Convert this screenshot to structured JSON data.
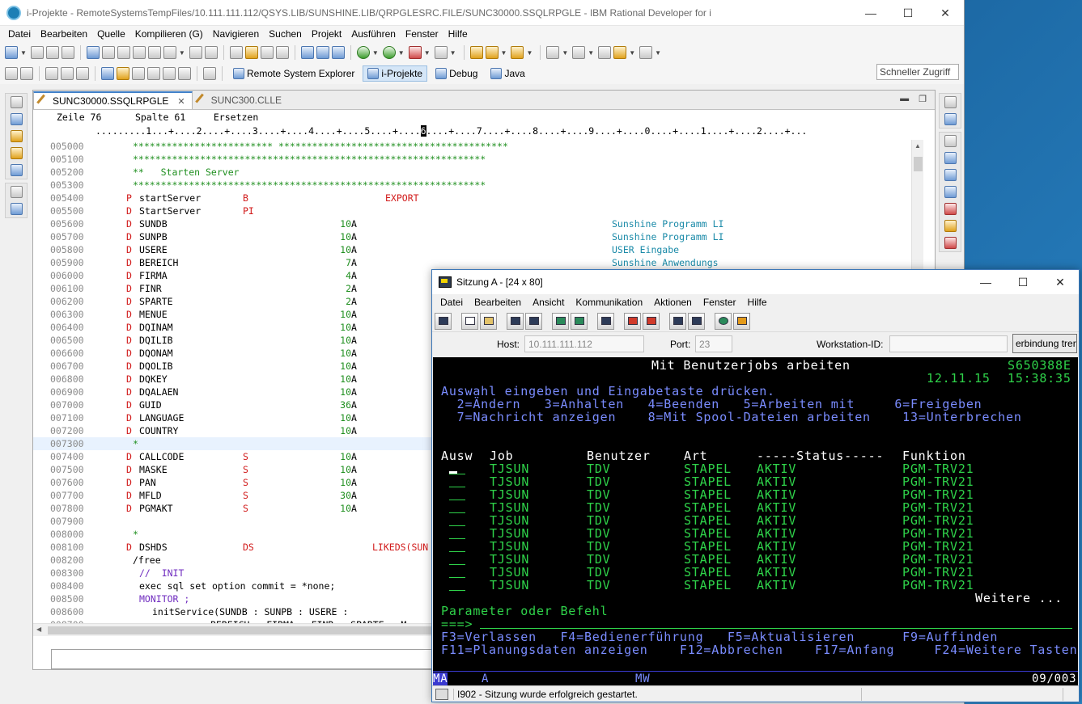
{
  "rdi": {
    "title": "i-Projekte - RemoteSystemsTempFiles/10.111.111.112/QSYS.LIB/SUNSHINE.LIB/QRPGLESRC.FILE/SUNC30000.SSQLRPGLE - IBM Rational Developer for i",
    "menu": [
      "Datei",
      "Bearbeiten",
      "Quelle",
      "Kompilieren (G)",
      "Navigieren",
      "Suchen",
      "Projekt",
      "Ausführen",
      "Fenster",
      "Hilfe"
    ],
    "perspectives": [
      {
        "label": "Remote System Explorer",
        "active": false
      },
      {
        "label": "i-Projekte",
        "active": true
      },
      {
        "label": "Debug",
        "active": false
      },
      {
        "label": "Java",
        "active": false
      }
    ],
    "quick_access": "Schneller Zugriff",
    "tabs": [
      {
        "label": "SUNC30000.SSQLRPGLE",
        "active": true
      },
      {
        "label": "SUNC300.CLLE",
        "active": false
      }
    ],
    "status": {
      "zeile": "Zeile 76",
      "spalte": "Spalte 61",
      "mode": "Ersetzen"
    },
    "ruler": ".........1...+....2....+....3....+....4....+....5....+....6....+....7....+....8....+....9....+....0....+....1....+....2....+...",
    "code": [
      {
        "seq": "005000",
        "star": "************************* *****************************************"
      },
      {
        "seq": "005100",
        "star": "***************************************************************"
      },
      {
        "seq": "005200",
        "star": "**   Starten Server"
      },
      {
        "seq": "005300",
        "star": "***************************************************************"
      },
      {
        "seq": "005400",
        "spec": "P",
        "name": "startServer",
        "kw": "B",
        "kwd": "EXPORT"
      },
      {
        "seq": "005500",
        "spec": "D",
        "name": "StartServer",
        "kw": "PI"
      },
      {
        "seq": "005600",
        "spec": "D",
        "name": "SUNDB",
        "len": "10",
        "typ": "A",
        "cmt": "Sunshine Programm LI"
      },
      {
        "seq": "005700",
        "spec": "D",
        "name": "SUNPB",
        "len": "10",
        "typ": "A",
        "cmt": "Sunshine Programm LI"
      },
      {
        "seq": "005800",
        "spec": "D",
        "name": "USERE",
        "len": "10",
        "typ": "A",
        "cmt": "USER Eingabe"
      },
      {
        "seq": "005900",
        "spec": "D",
        "name": "BEREICH",
        "len": "7",
        "typ": "A",
        "cmt": "Sunshine Anwendungs"
      },
      {
        "seq": "006000",
        "spec": "D",
        "name": "FIRMA",
        "len": "4",
        "typ": "A"
      },
      {
        "seq": "006100",
        "spec": "D",
        "name": "FINR",
        "len": "2",
        "typ": "A"
      },
      {
        "seq": "006200",
        "spec": "D",
        "name": "SPARTE",
        "len": "2",
        "typ": "A"
      },
      {
        "seq": "006300",
        "spec": "D",
        "name": "MENUE",
        "len": "10",
        "typ": "A"
      },
      {
        "seq": "006400",
        "spec": "D",
        "name": "DQINAM",
        "len": "10",
        "typ": "A"
      },
      {
        "seq": "006500",
        "spec": "D",
        "name": "DQILIB",
        "len": "10",
        "typ": "A"
      },
      {
        "seq": "006600",
        "spec": "D",
        "name": "DQONAM",
        "len": "10",
        "typ": "A"
      },
      {
        "seq": "006700",
        "spec": "D",
        "name": "DQOLIB",
        "len": "10",
        "typ": "A"
      },
      {
        "seq": "006800",
        "spec": "D",
        "name": "DQKEY",
        "len": "10",
        "typ": "A"
      },
      {
        "seq": "006900",
        "spec": "D",
        "name": "DQALAEN",
        "len": "10",
        "typ": "A"
      },
      {
        "seq": "007000",
        "spec": "D",
        "name": "GUID",
        "len": "36",
        "typ": "A"
      },
      {
        "seq": "007100",
        "spec": "D",
        "name": "LANGUAGE",
        "len": "10",
        "typ": "A"
      },
      {
        "seq": "007200",
        "spec": "D",
        "name": "COUNTRY",
        "len": "10",
        "typ": "A"
      },
      {
        "seq": "007300",
        "star": "*",
        "hl": true
      },
      {
        "seq": "007400",
        "spec": "D",
        "name": "CALLCODE",
        "kw": "S",
        "len": "10",
        "typ": "A"
      },
      {
        "seq": "007500",
        "spec": "D",
        "name": "MASKE",
        "kw": "S",
        "len": "10",
        "typ": "A"
      },
      {
        "seq": "007600",
        "spec": "D",
        "name": "PAN",
        "kw": "S",
        "len": "10",
        "typ": "A"
      },
      {
        "seq": "007700",
        "spec": "D",
        "name": "MFLD",
        "kw": "S",
        "len": "30",
        "typ": "A"
      },
      {
        "seq": "007800",
        "spec": "D",
        "name": "PGMAKT",
        "kw": "S",
        "len": "10",
        "typ": "A"
      },
      {
        "seq": "007900"
      },
      {
        "seq": "008000",
        "star": "*"
      },
      {
        "seq": "008100",
        "spec": "D",
        "name": "DSHDS",
        "kw": "DS",
        "kwd": "LIKEDS(SUN"
      },
      {
        "seq": "008200",
        "free": "/free",
        "free_indent": 1,
        "black": true
      },
      {
        "seq": "008300",
        "free": "//  INIT",
        "free_indent": 2
      },
      {
        "seq": "008400",
        "free": "exec sql set option commit = *none;",
        "free_indent": 2,
        "black": true
      },
      {
        "seq": "008500",
        "free": "MONITOR ;",
        "free_indent": 2
      },
      {
        "seq": "008600",
        "free": "initService(SUNDB : SUNPB : USERE :",
        "free_indent": 4,
        "black": true
      },
      {
        "seq": "008700",
        "free": "BEREICH : FIRMA : FINR : SPARTE : M",
        "free_indent": 13,
        "black": true
      }
    ]
  },
  "session": {
    "title": "Sitzung A - [24 x 80]",
    "menu": [
      "Datei",
      "Bearbeiten",
      "Ansicht",
      "Kommunikation",
      "Aktionen",
      "Fenster",
      "Hilfe"
    ],
    "host_label": "Host:",
    "host_value": "10.111.111.112",
    "port_label": "Port:",
    "port_value": "23",
    "wsid_label": "Workstation-ID:",
    "wsid_value": "",
    "connect_button": "erbindung trer",
    "screen": {
      "title": "Mit Benutzerjobs arbeiten",
      "system": "S650388E",
      "date": "12.11.15",
      "time": "15:38:35",
      "instruction": "Auswahl eingeben und Eingabetaste drücken.",
      "options1": "  2=Ändern   3=Anhalten   4=Beenden   5=Arbeiten mit     6=Freigeben",
      "options2": "  7=Nachricht anzeigen    8=Mit Spool-Dateien arbeiten    13=Unterbrechen",
      "headers": {
        "ausw": "Ausw",
        "job": "Job",
        "user": "Benutzer",
        "art": "Art",
        "status": "-----Status-----",
        "funktion": "Funktion"
      },
      "rows": [
        {
          "job": "TJSUN",
          "user": "TDV",
          "art": "STAPEL",
          "status": "AKTIV",
          "funktion": "PGM-TRV21"
        },
        {
          "job": "TJSUN",
          "user": "TDV",
          "art": "STAPEL",
          "status": "AKTIV",
          "funktion": "PGM-TRV21"
        },
        {
          "job": "TJSUN",
          "user": "TDV",
          "art": "STAPEL",
          "status": "AKTIV",
          "funktion": "PGM-TRV21"
        },
        {
          "job": "TJSUN",
          "user": "TDV",
          "art": "STAPEL",
          "status": "AKTIV",
          "funktion": "PGM-TRV21"
        },
        {
          "job": "TJSUN",
          "user": "TDV",
          "art": "STAPEL",
          "status": "AKTIV",
          "funktion": "PGM-TRV21"
        },
        {
          "job": "TJSUN",
          "user": "TDV",
          "art": "STAPEL",
          "status": "AKTIV",
          "funktion": "PGM-TRV21"
        },
        {
          "job": "TJSUN",
          "user": "TDV",
          "art": "STAPEL",
          "status": "AKTIV",
          "funktion": "PGM-TRV21"
        },
        {
          "job": "TJSUN",
          "user": "TDV",
          "art": "STAPEL",
          "status": "AKTIV",
          "funktion": "PGM-TRV21"
        },
        {
          "job": "TJSUN",
          "user": "TDV",
          "art": "STAPEL",
          "status": "AKTIV",
          "funktion": "PGM-TRV21"
        },
        {
          "job": "TJSUN",
          "user": "TDV",
          "art": "STAPEL",
          "status": "AKTIV",
          "funktion": "PGM-TRV21"
        }
      ],
      "more": "Weitere ...",
      "param_label": "Parameter oder Befehl",
      "prompt": "===>",
      "fkeys1": "F3=Verlassen   F4=Bedienerführung   F5=Aktualisieren      F9=Auffinden",
      "fkeys2": "F11=Planungsdaten anzeigen    F12=Abbrechen    F17=Anfang     F24=Weitere Tasten"
    },
    "oia": {
      "ma": "MA",
      "a": "A",
      "mw": "MW",
      "pos": "09/003"
    },
    "status_msg": "I902 - Sitzung wurde erfolgreich gestartet."
  }
}
